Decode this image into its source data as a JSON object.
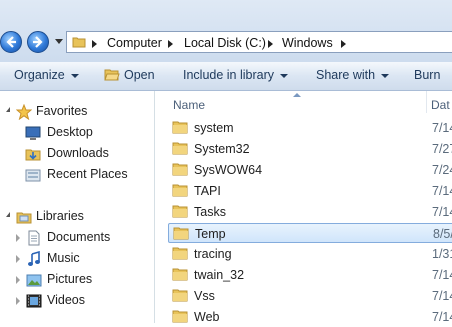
{
  "address": {
    "crumbs": [
      "Computer",
      "Local Disk (C:)",
      "Windows"
    ]
  },
  "toolbar": {
    "organize": "Organize",
    "open": "Open",
    "include": "Include in library",
    "share": "Share with",
    "burn": "Burn"
  },
  "nav": {
    "favorites": {
      "label": "Favorites",
      "items": [
        "Desktop",
        "Downloads",
        "Recent Places"
      ]
    },
    "libraries": {
      "label": "Libraries",
      "items": [
        "Documents",
        "Music",
        "Pictures",
        "Videos"
      ]
    }
  },
  "files": {
    "columns": {
      "name": "Name",
      "date": "Dat"
    },
    "rows": [
      {
        "name": "system",
        "date": "7/14"
      },
      {
        "name": "System32",
        "date": "7/27"
      },
      {
        "name": "SysWOW64",
        "date": "7/24"
      },
      {
        "name": "TAPI",
        "date": "7/14"
      },
      {
        "name": "Tasks",
        "date": "7/14"
      },
      {
        "name": "Temp",
        "date": "8/5/"
      },
      {
        "name": "tracing",
        "date": "1/31"
      },
      {
        "name": "twain_32",
        "date": "7/14"
      },
      {
        "name": "Vss",
        "date": "7/14"
      },
      {
        "name": "Web",
        "date": "7/14"
      }
    ],
    "selected_index": 5
  },
  "colors": {
    "selection_fill": "#d0e5fb",
    "selection_border": "#84acdd",
    "folder": "#e8c35a",
    "toolbar_text": "#1e395b"
  }
}
